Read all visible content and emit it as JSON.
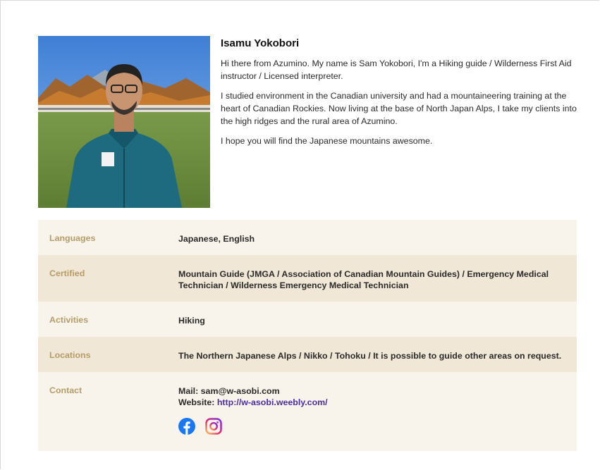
{
  "profile": {
    "name": "Isamu Yokobori",
    "paragraphs": [
      "Hi there from Azumino. My name is Sam Yokobori, I'm a Hiking guide / Wilderness First Aid instructor / Licensed interpreter.",
      "I studied environment in the Canadian university and had a mountaineering training at the heart of Canadian Rockies. Now living at the base of North Japan Alps, I take my clients into the high ridges and the rural area of Azumino.",
      "I hope you will find the Japanese mountains awesome."
    ]
  },
  "info": {
    "languages": {
      "label": "Languages",
      "value": "Japanese, English"
    },
    "certified": {
      "label": "Certified",
      "value": "Mountain Guide (JMGA / Association of Canadian Mountain Guides) / Emergency Medical Technician / Wilderness Emergency Medical Technician"
    },
    "activities": {
      "label": "Activities",
      "value": "Hiking"
    },
    "locations": {
      "label": "Locations",
      "value": "The Northern Japanese Alps / Nikko / Tohoku / It is possible to guide other areas on request."
    },
    "contact": {
      "label": "Contact",
      "mail": "Mail: sam@w-asobi.com",
      "website_label": "Website: ",
      "website_url": "http://w-asobi.weebly.com/"
    }
  },
  "social": {
    "icons": [
      "facebook-icon",
      "instagram-icon"
    ]
  },
  "colors": {
    "label": "#b59c68",
    "row_light": "#f8f4eb",
    "row_dark": "#f0e7d6",
    "link": "#4b2da6",
    "facebook": "#1877f2"
  }
}
